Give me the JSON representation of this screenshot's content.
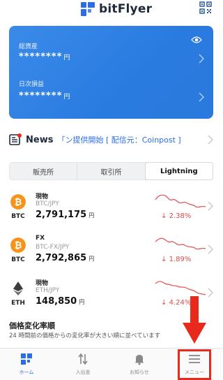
{
  "app": {
    "name": "bitFlyer"
  },
  "asset_card": {
    "total_label": "総資産",
    "total_value": "********",
    "total_unit": "円",
    "daily_label": "日次損益",
    "daily_value": "********",
    "daily_unit": "円"
  },
  "news": {
    "label": "News",
    "ticker": "「ン提供開始 [ 配信元：Coinpost ]"
  },
  "segments": [
    "販売所",
    "取引所",
    "Lightning"
  ],
  "active_segment": "Lightning",
  "coins": [
    {
      "symbol": "BTC",
      "type": "現物",
      "pair": "BTC/JPY",
      "price": "2,791,175",
      "price_unit": "円",
      "change": "2.38%",
      "direction": "down",
      "color": "#f7931a"
    },
    {
      "symbol": "BTC",
      "type": "FX",
      "pair": "BTC-FX/JPY",
      "price": "2,792,865",
      "price_unit": "円",
      "change": "1.89%",
      "direction": "down",
      "color": "#f7931a"
    },
    {
      "symbol": "ETH",
      "type": "現物",
      "pair": "ETH/JPY",
      "price": "148,850",
      "price_unit": "円",
      "change": "4.24%",
      "direction": "down",
      "color": "#3c3c3d"
    }
  ],
  "ranking": {
    "title": "価格変化率順",
    "subtitle": "24 時間前の価格からの変化率が大きい順に並べています"
  },
  "tabbar": [
    {
      "label": "ホーム",
      "icon": "home-icon",
      "active": true
    },
    {
      "label": "入出金",
      "icon": "transfer-icon",
      "active": false
    },
    {
      "label": "お知らせ",
      "icon": "bell-icon",
      "active": false
    },
    {
      "label": "メニュー",
      "icon": "menu-icon",
      "active": false
    }
  ],
  "colors": {
    "accent": "#2a6de8",
    "negative": "#e04848",
    "highlight": "#e8291c"
  }
}
